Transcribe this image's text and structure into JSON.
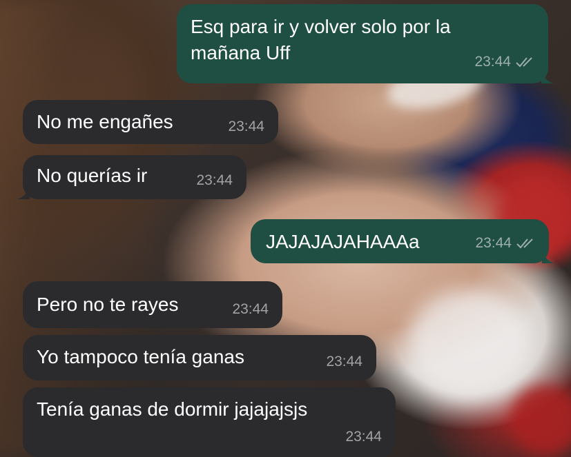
{
  "colors": {
    "incoming_bubble": "#2b2b2d",
    "outgoing_bubble": "#1f4e43",
    "text": "#ffffff",
    "timestamp": "rgba(235,235,235,0.62)"
  },
  "messages": [
    {
      "direction": "outgoing",
      "text": "Esq para ir y volver solo por la\nmañana Uff",
      "time": "23:44",
      "status_icon": "double-check-icon"
    },
    {
      "direction": "incoming",
      "text": "No me engañes",
      "time": "23:44"
    },
    {
      "direction": "incoming",
      "text": "No querías ir",
      "time": "23:44"
    },
    {
      "direction": "outgoing",
      "text": "JAJAJAJAHAAAa",
      "time": "23:44",
      "status_icon": "double-check-icon"
    },
    {
      "direction": "incoming",
      "text": "Pero no te rayes",
      "time": "23:44"
    },
    {
      "direction": "incoming",
      "text": "Yo tampoco tenía ganas",
      "time": "23:44"
    },
    {
      "direction": "incoming",
      "text": "Tenía ganas de dormir jajajajsjs",
      "time": "23:44"
    }
  ]
}
